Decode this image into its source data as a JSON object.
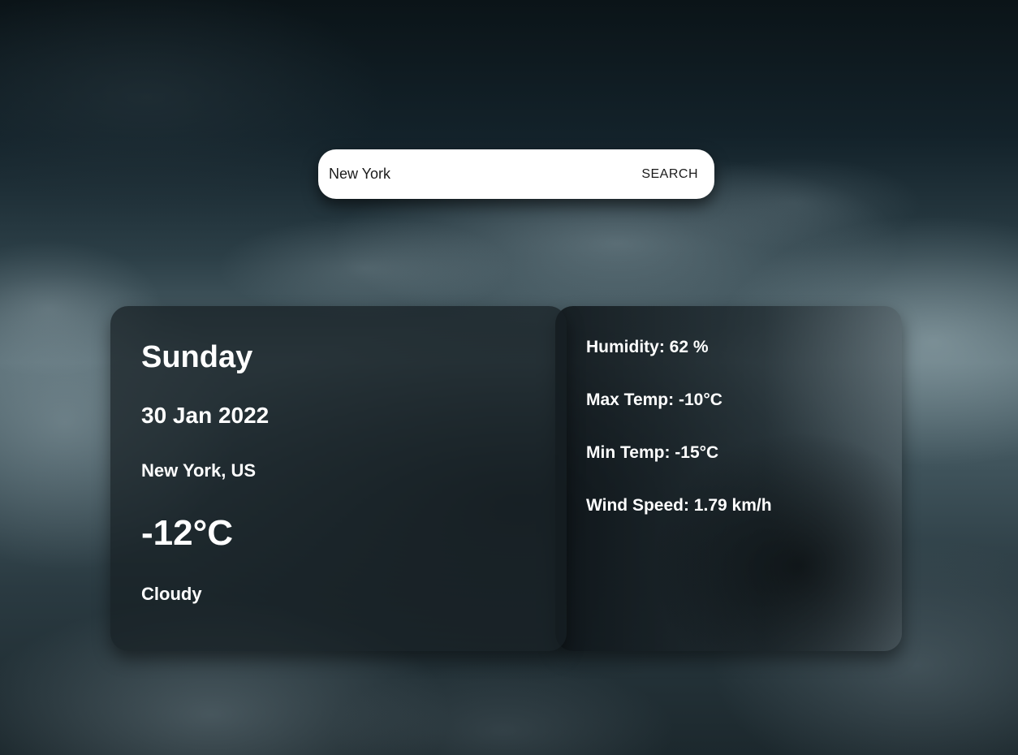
{
  "search": {
    "value": "New York",
    "button_label": "SEARCH"
  },
  "current": {
    "day": "Sunday",
    "date": "30 Jan 2022",
    "location": "New York, US",
    "temperature": "-12°C",
    "condition": "Cloudy"
  },
  "details": {
    "humidity": "Humidity: 62 %",
    "max_temp": "Max Temp: -10°C",
    "min_temp": "Min Temp: -15°C",
    "wind_speed": "Wind Speed: 1.79 km/h"
  }
}
